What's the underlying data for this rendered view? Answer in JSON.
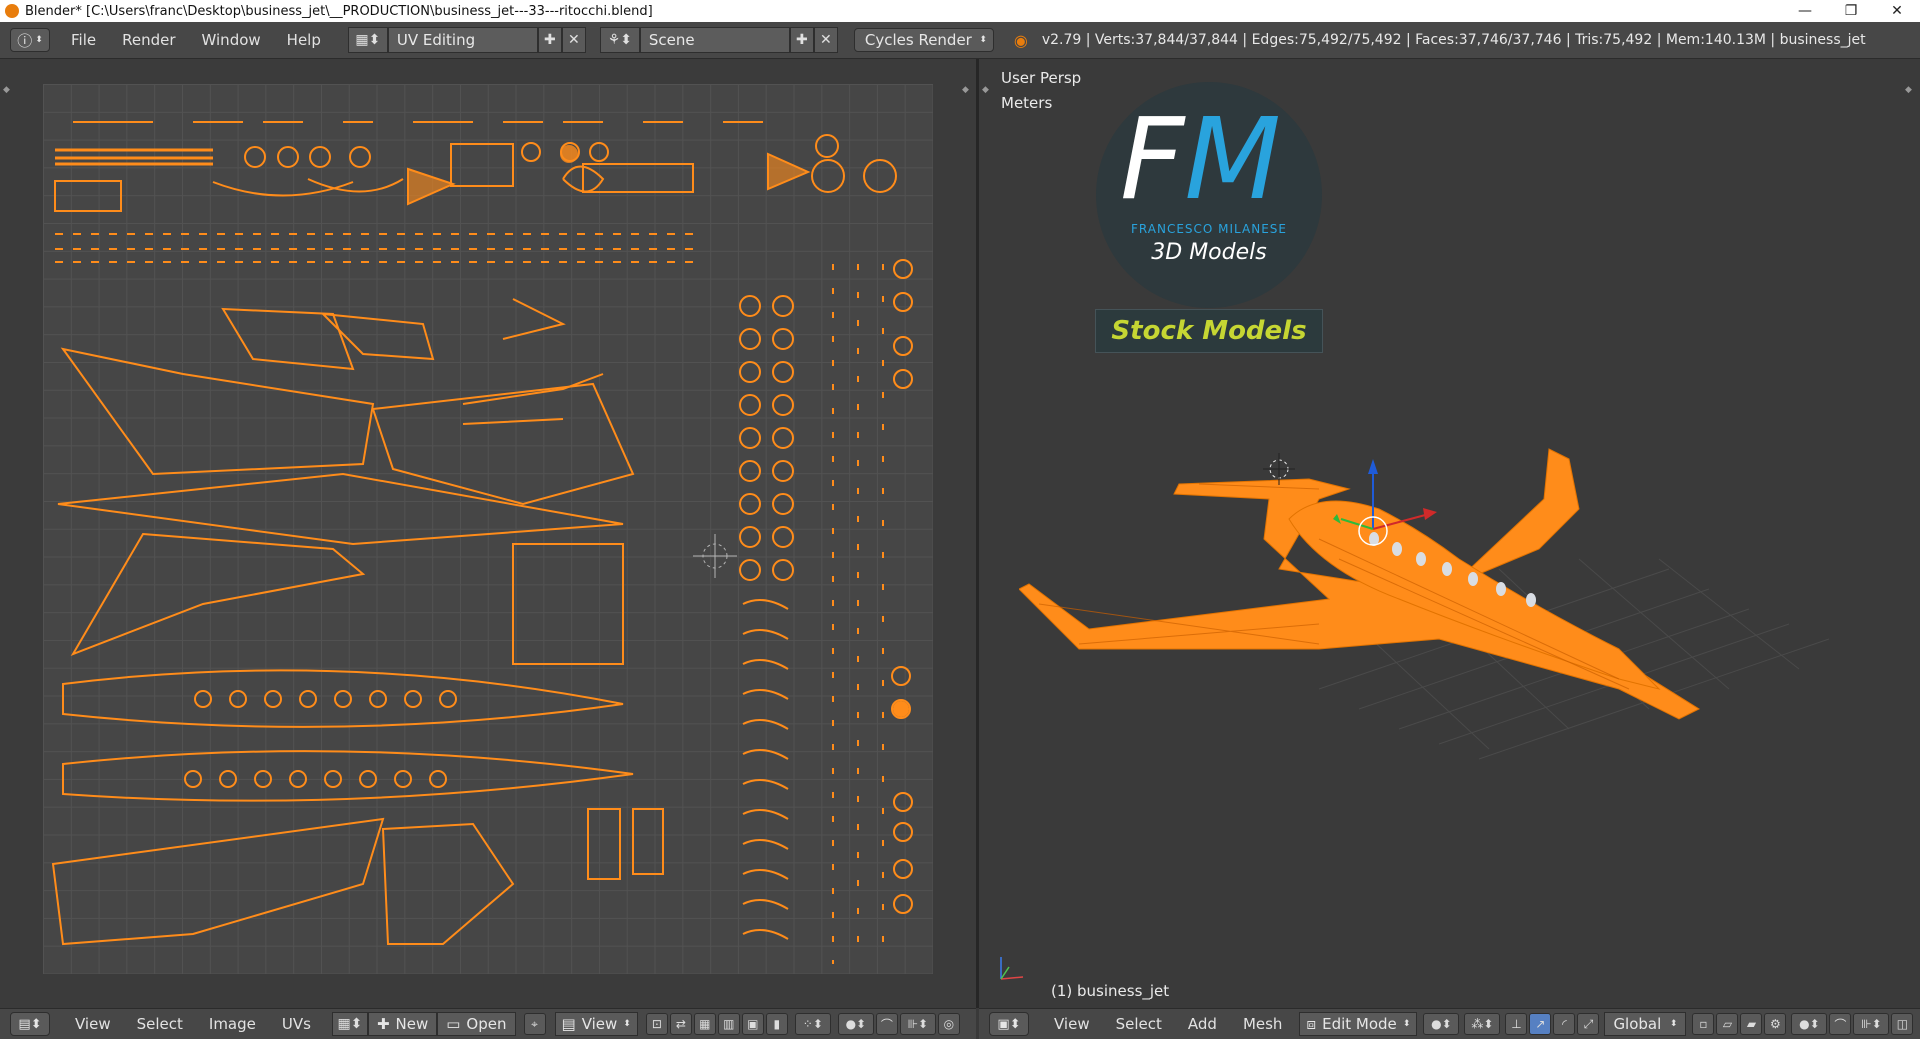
{
  "window": {
    "title": "Blender* [C:\\Users\\franc\\Desktop\\business_jet\\__PRODUCTION\\business_jet---33---ritocchi.blend]",
    "controls": [
      "—",
      "❐",
      "✕"
    ]
  },
  "topbar": {
    "menus": [
      "File",
      "Render",
      "Window",
      "Help"
    ],
    "screen_layout": "UV Editing",
    "scene": "Scene",
    "render_engine": "Cycles Render",
    "stats": "v2.79 | Verts:37,844/37,844 | Edges:75,492/75,492 | Faces:37,746/37,746 | Tris:75,492 | Mem:140.13M | business_jet"
  },
  "uv_editor": {
    "menus": [
      "View",
      "Select",
      "Image",
      "UVs"
    ],
    "new_label": "New",
    "open_label": "Open",
    "view_label": "View"
  },
  "viewport": {
    "view_name": "User Persp",
    "units": "Meters",
    "object_label": "(1) business_jet",
    "logo": {
      "letters_f": "F",
      "letters_m": "M",
      "company": "FRANCESCO MILANESE",
      "tagline": "3D Models",
      "banner": "Stock Models"
    },
    "menus": [
      "View",
      "Select",
      "Add",
      "Mesh"
    ],
    "mode": "Edit Mode",
    "orientation": "Global"
  },
  "colors": {
    "accent": "#ff8c1a",
    "panel": "#474747",
    "logo_blue": "#29a3dd",
    "banner_text": "#c6d633"
  }
}
